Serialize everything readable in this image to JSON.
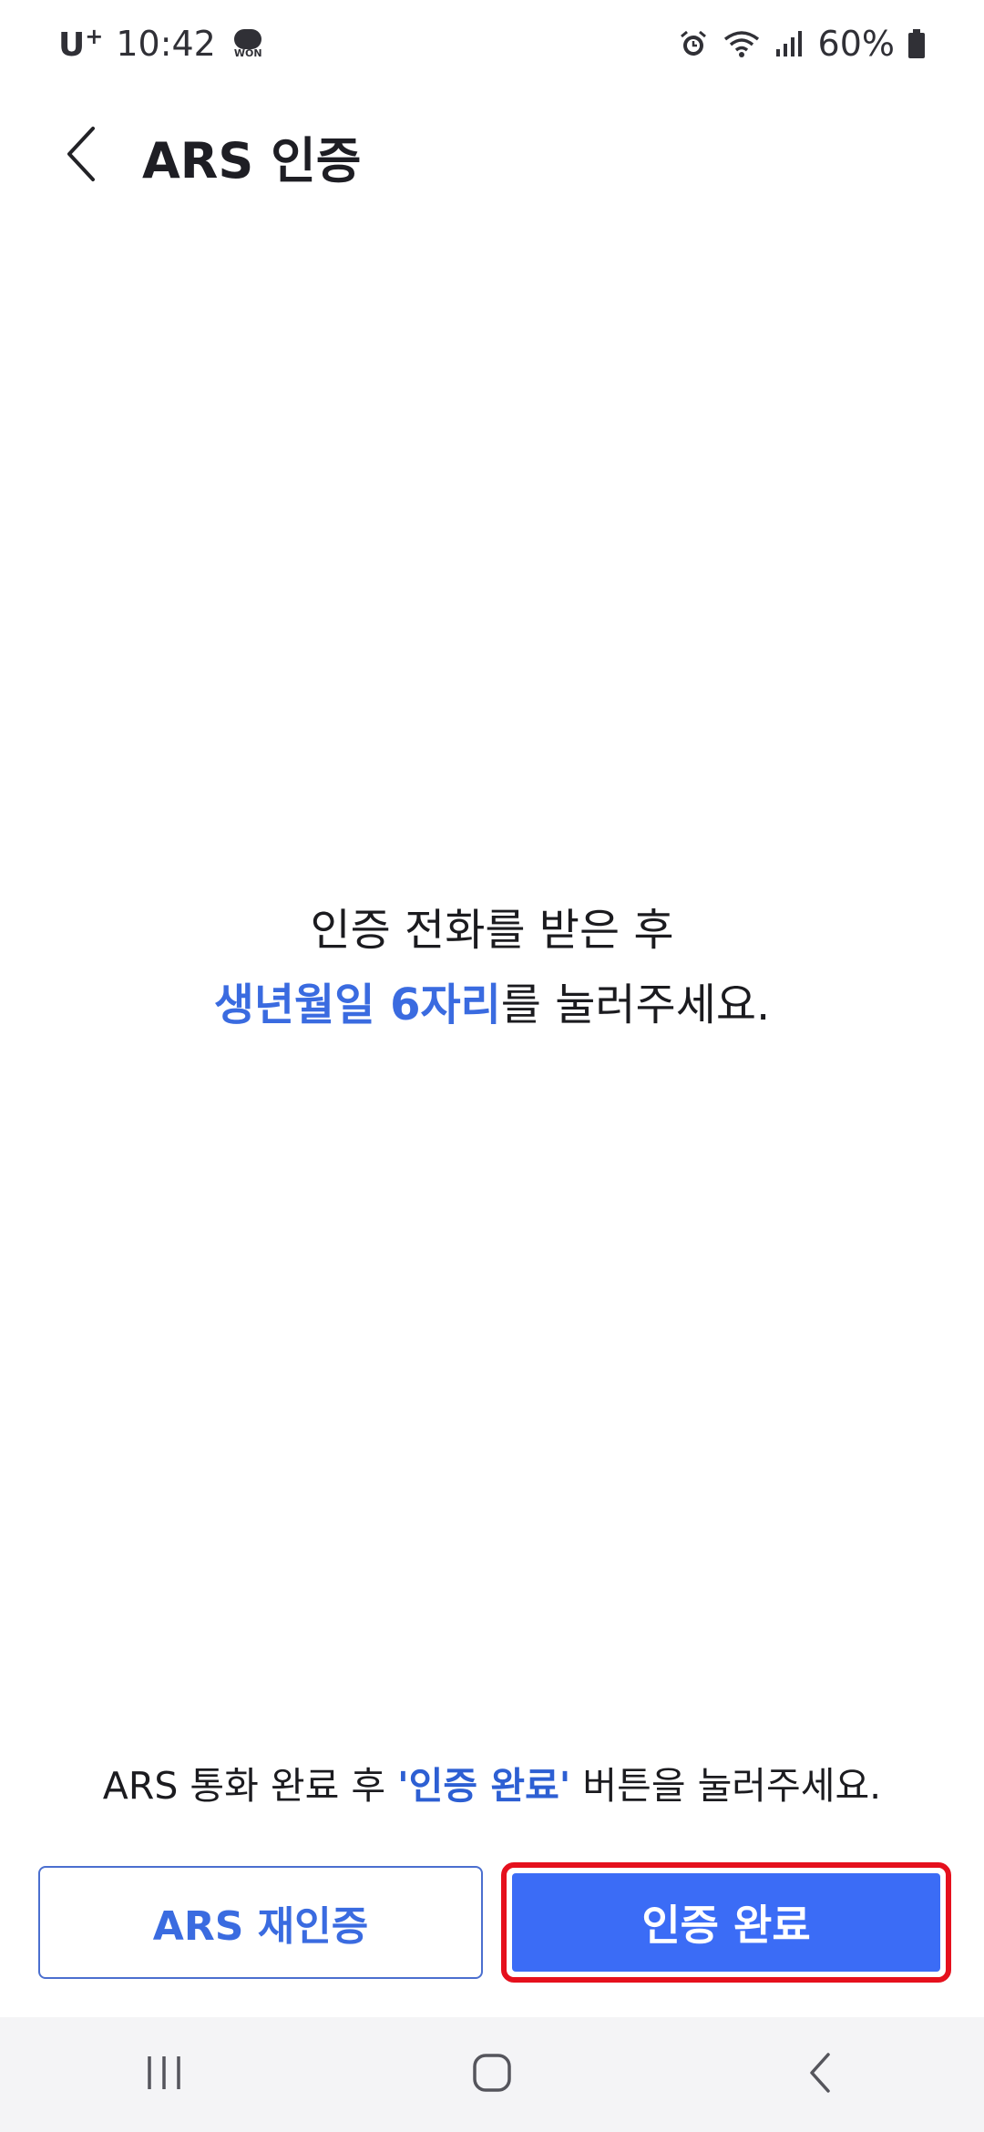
{
  "status_bar": {
    "carrier": "U",
    "carrier_sup": "+",
    "time": "10:42",
    "notification_icon_text": "WON",
    "battery_percent": "60%",
    "icons": [
      "alarm-icon",
      "wifi-icon",
      "signal-icon",
      "battery-icon"
    ]
  },
  "app_bar": {
    "back_icon": "back-arrow-icon",
    "title": "ARS 인증"
  },
  "instruction": {
    "line1": "인증 전화를 받은 후",
    "line2_accent": "생년월일 6자리",
    "line2_rest": "를 눌러주세요."
  },
  "helper": {
    "prefix": "ARS 통화 완료 후 ",
    "accent": "'인증 완료'",
    "suffix": " 버튼을 눌러주세요."
  },
  "buttons": {
    "reauth_label": "ARS 재인증",
    "complete_label": "인증 완료"
  },
  "colors": {
    "accent": "#3a6be0",
    "primary_button": "#3b6cf6",
    "highlight_border": "#e5101d"
  },
  "nav_bar": {
    "icons": [
      "recent-apps-icon",
      "home-icon",
      "back-icon"
    ]
  }
}
